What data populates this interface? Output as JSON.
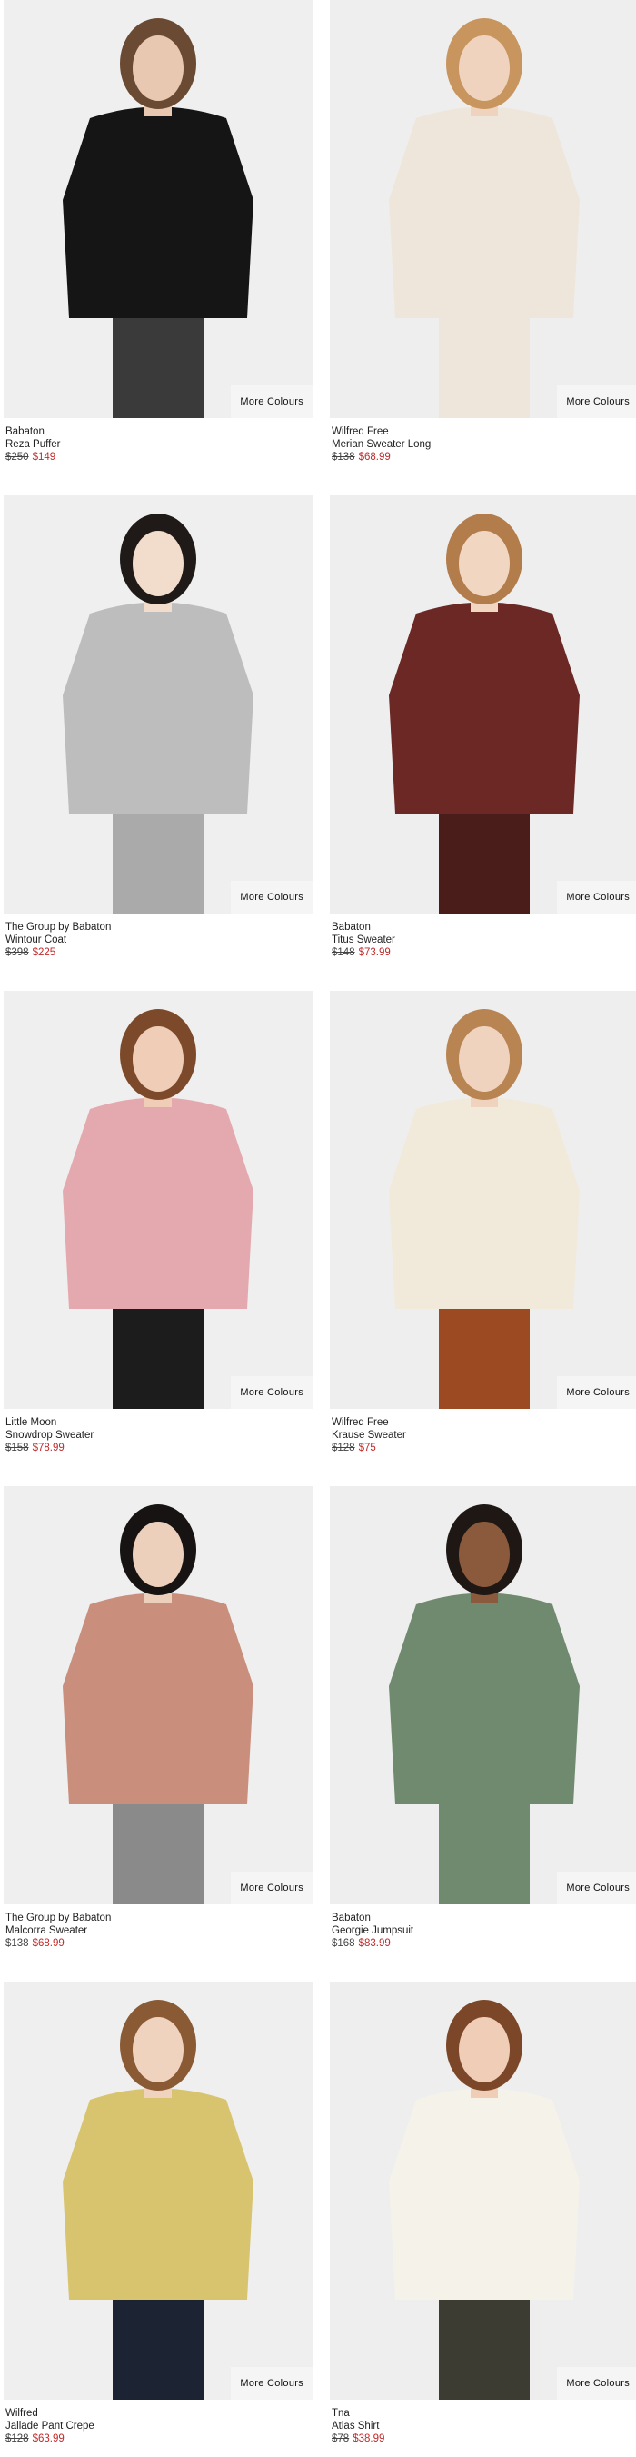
{
  "products": [
    {
      "brand": "Babaton",
      "name": "Reza Puffer",
      "was": "$250",
      "now": "$149",
      "more": "More Colours",
      "bg": "#efefef",
      "garment": "#151515",
      "skin": "#e8c8b0",
      "hair": "#6a4a33",
      "pants": "#3a3a3a"
    },
    {
      "brand": "Wilfred Free",
      "name": "Merian Sweater Long",
      "was": "$138",
      "now": "$68.99",
      "more": "More Colours",
      "bg": "#eeeeee",
      "garment": "#efe6db",
      "skin": "#f0d3bf",
      "hair": "#c7955d",
      "pants": "#efe6db"
    },
    {
      "brand": "The Group by Babaton",
      "name": "Wintour Coat",
      "was": "$398",
      "now": "$225",
      "more": "More Colours",
      "bg": "#efefef",
      "garment": "#bdbdbd",
      "skin": "#f2dccb",
      "hair": "#1f1a18",
      "pants": "#aaaaaa"
    },
    {
      "brand": "Babaton",
      "name": "Titus Sweater",
      "was": "$148",
      "now": "$73.99",
      "more": "More Colours",
      "bg": "#eeeeee",
      "garment": "#6b2824",
      "skin": "#f1d6c2",
      "hair": "#b27c4b",
      "pants": "#4a1d1a"
    },
    {
      "brand": "Little Moon",
      "name": "Snowdrop Sweater",
      "was": "$158",
      "now": "$78.99",
      "more": "More Colours",
      "bg": "#efefef",
      "garment": "#e4a9ae",
      "skin": "#efcdb7",
      "hair": "#7c4a2a",
      "pants": "#1c1c1c"
    },
    {
      "brand": "Wilfred Free",
      "name": "Krause Sweater",
      "was": "$128",
      "now": "$75",
      "more": "More Colours",
      "bg": "#eeeeee",
      "garment": "#f1e9da",
      "skin": "#f0d3bf",
      "hair": "#b88452",
      "pants": "#9c4a22"
    },
    {
      "brand": "The Group by Babaton",
      "name": "Malcorra Sweater",
      "was": "$138",
      "now": "$68.99",
      "more": "More Colours",
      "bg": "#efefef",
      "garment": "#c98e7c",
      "skin": "#ecd0bb",
      "hair": "#171313",
      "pants": "#8a8a8a"
    },
    {
      "brand": "Babaton",
      "name": "Georgie Jumpsuit",
      "was": "$168",
      "now": "$83.99",
      "more": "More Colours",
      "bg": "#eeeeee",
      "garment": "#6f8a6e",
      "skin": "#8b5a3c",
      "hair": "#1e1714",
      "pants": "#6f8a6e"
    },
    {
      "brand": "Wilfred",
      "name": "Jallade Pant Crepe",
      "was": "$128",
      "now": "$63.99",
      "more": "More Colours",
      "bg": "#efefef",
      "garment": "#d8c46f",
      "skin": "#f0d3bf",
      "hair": "#8a5a35",
      "pants": "#1c2433"
    },
    {
      "brand": "Tna",
      "name": "Atlas Shirt",
      "was": "$78",
      "now": "$38.99",
      "more": "More Colours",
      "bg": "#eeeeee",
      "garment": "#f5f2ea",
      "skin": "#efcdb7",
      "hair": "#7b4728",
      "pants": "#3c3c33"
    }
  ]
}
